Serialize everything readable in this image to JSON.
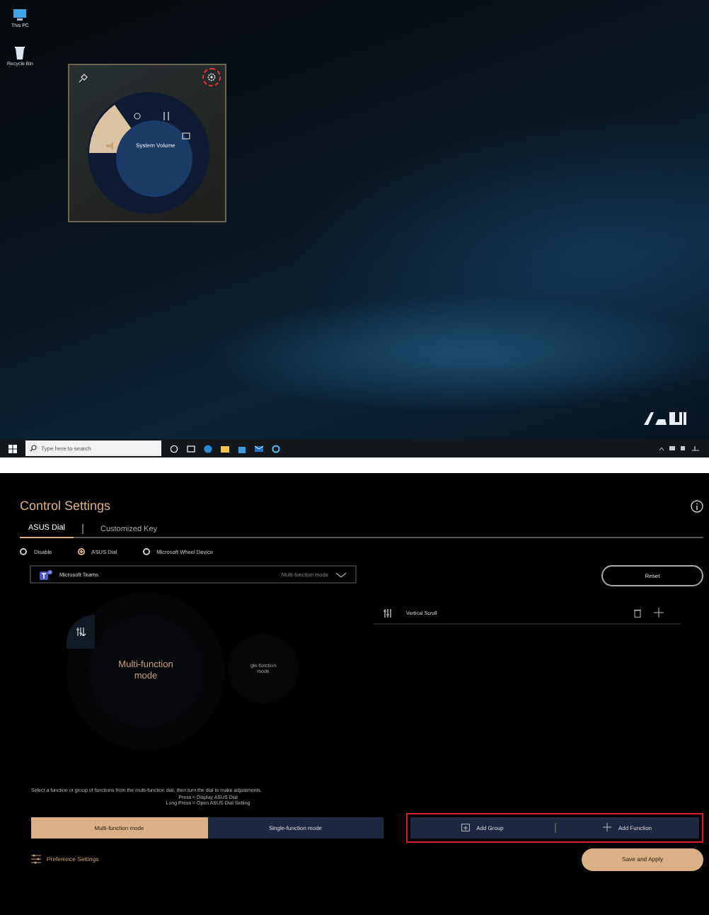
{
  "desktop": {
    "icons": [
      {
        "label": "This PC",
        "kind": "computer"
      },
      {
        "label": "Recycle Bin",
        "kind": "bin"
      }
    ],
    "dial_widget": {
      "label": "System Volume",
      "settings_highlighted": true
    },
    "taskbar": {
      "search": {
        "placeholder": "Type here to search"
      }
    }
  },
  "control_settings": {
    "title": "Control Settings",
    "tabs": [
      {
        "label": "ASUS Dial",
        "selected": true
      },
      {
        "label": "Customized Key",
        "selected": false
      }
    ],
    "device_options": [
      {
        "label": "Disable",
        "selected": false
      },
      {
        "label": "ASUS Dial",
        "selected": true
      },
      {
        "label": "Microsoft Wheel Device",
        "selected": false
      }
    ],
    "app_select": {
      "app": "Microsoft Teams",
      "mode": "Multi-function mode"
    },
    "reset_button": "Reset",
    "functions": [
      {
        "label": "Vertical Scroll"
      }
    ],
    "dial_preview": {
      "primary": "Multi-function mode",
      "secondary": "gle-function mode"
    },
    "instructions": [
      "Select a function or group of functions from the multi-function dial, then turn the dial to make adjustments.",
      "Press = Display ASUS Dial",
      "Long Press = Open ASUS Dial Setting"
    ],
    "mode_buttons": [
      {
        "label": "Multi-function mode",
        "selected": true
      },
      {
        "label": "Single-function mode",
        "selected": false
      }
    ],
    "add_bar": {
      "highlighted": true,
      "add_group": "Add Group",
      "add_function": "Add Function"
    },
    "preference_settings": "Preference Settings",
    "save_button": "Save and Apply"
  }
}
